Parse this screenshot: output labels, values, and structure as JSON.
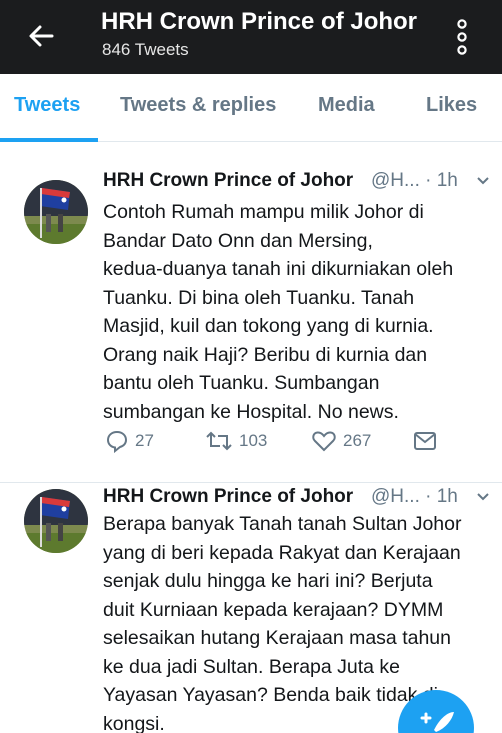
{
  "header": {
    "title": "HRH Crown Prince of Johor",
    "subtitle": "846 Tweets"
  },
  "tabs": [
    {
      "label": "Tweets",
      "active": true
    },
    {
      "label": "Tweets & replies",
      "active": false
    },
    {
      "label": "Media",
      "active": false
    },
    {
      "label": "Likes",
      "active": false
    }
  ],
  "tweets": [
    {
      "name": "HRH Crown Prince of Johor",
      "handle_time": "@H... · 1h",
      "lines": [
        "Contoh Rumah mampu milik Johor di",
        "Bandar Dato Onn dan Mersing,",
        "kedua-duanya tanah ini dikurniakan oleh",
        "Tuanku. Di bina oleh Tuanku. Tanah",
        "Masjid, kuil dan tokong yang di kurnia.",
        "Orang naik Haji? Beribu di kurnia dan",
        "bantu oleh Tuanku. Sumbangan",
        "sumbangan ke Hospital. No news."
      ],
      "replies": "27",
      "retweets": "103",
      "likes": "267"
    },
    {
      "name": "HRH Crown Prince of Johor",
      "handle_time": "@H... · 1h",
      "lines": [
        "Berapa banyak Tanah tanah Sultan Johor",
        "yang di beri kepada Rakyat dan Kerajaan",
        "senjak dulu hingga ke hari ini? Berjuta",
        "duit Kurniaan kepada kerajaan? DYMM",
        "selesaikan hutang Kerajaan masa tahun",
        "ke dua jadi Sultan. Berapa Juta ke",
        "Yayasan Yayasan? Benda baik tidak di",
        "kongsi."
      ]
    }
  ],
  "colors": {
    "accent": "#1da1f2",
    "header_bg": "#1b1c1e",
    "muted": "#657786"
  },
  "icons": [
    "back-arrow-icon",
    "more-vertical-icon",
    "reply-icon",
    "retweet-icon",
    "like-icon",
    "message-icon",
    "compose-icon"
  ]
}
